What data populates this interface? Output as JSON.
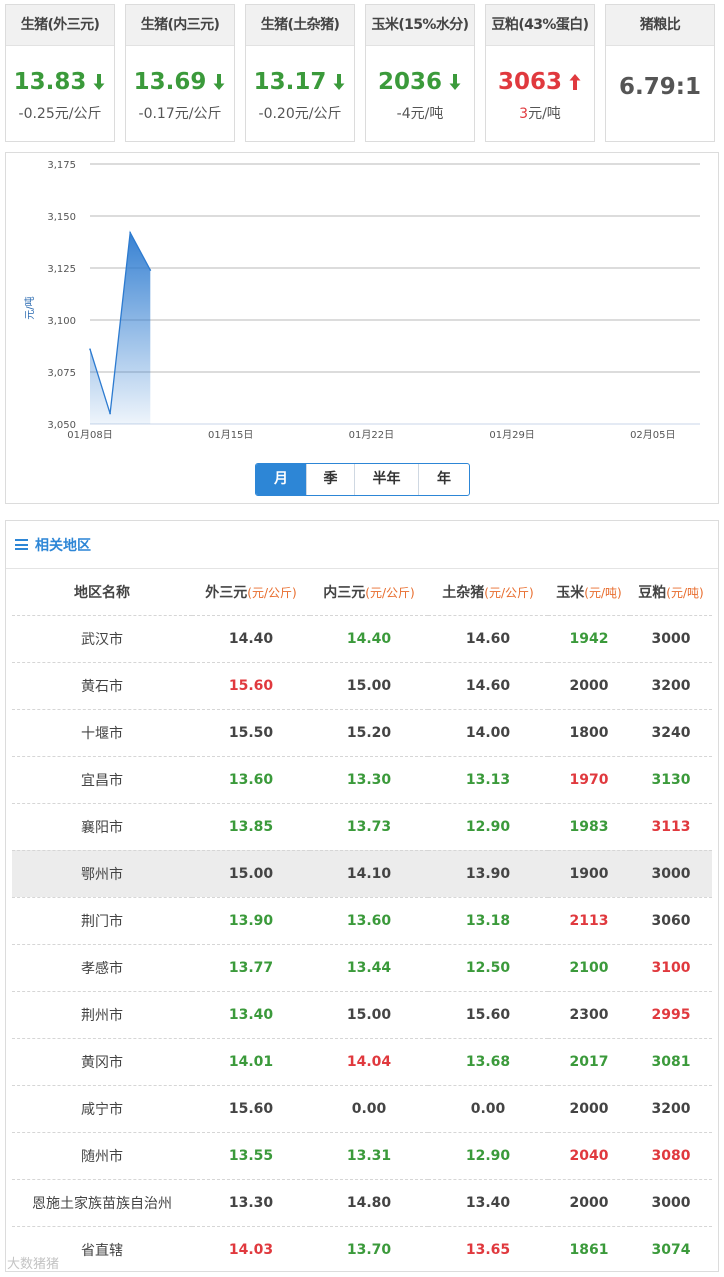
{
  "cards": [
    {
      "title": "生猪(外三元)",
      "price": "13.83",
      "change": "-0.25元/公斤",
      "dir": "down"
    },
    {
      "title": "生猪(内三元)",
      "price": "13.69",
      "change": "-0.17元/公斤",
      "dir": "down"
    },
    {
      "title": "生猪(土杂猪)",
      "price": "13.17",
      "change": "-0.20元/公斤",
      "dir": "down"
    },
    {
      "title": "玉米(15%水分)",
      "price": "2036",
      "change": "-4元/吨",
      "dir": "down"
    },
    {
      "title": "豆粕(43%蛋白)",
      "price": "3063",
      "change": "3元/吨",
      "dir": "up"
    },
    {
      "title": "猪粮比",
      "price": "6.79:1",
      "change": "",
      "dir": "none"
    }
  ],
  "chart_data": {
    "type": "area",
    "ylabel": "元/吨",
    "ylim": [
      3050,
      3175
    ],
    "yticks": [
      "3,175",
      "3,150",
      "3,125",
      "3,100",
      "3,075",
      "3,050"
    ],
    "xticks": [
      "01月08日",
      "01月15日",
      "01月22日",
      "01月29日",
      "02月05日"
    ],
    "x": [
      "01月08日",
      "01月09日",
      "01月10日",
      "01月11日"
    ],
    "values": [
      3086,
      3055,
      3142,
      3124
    ],
    "color": "#2d7bd0"
  },
  "range_tabs": [
    "月",
    "季",
    "半年",
    "年"
  ],
  "region": {
    "title": "相关地区",
    "columns": [
      {
        "label": "地区名称",
        "unit": ""
      },
      {
        "label": "外三元",
        "unit": "(元/公斤)"
      },
      {
        "label": "内三元",
        "unit": "(元/公斤)"
      },
      {
        "label": "土杂猪",
        "unit": "(元/公斤)"
      },
      {
        "label": "玉米",
        "unit": "(元/吨)"
      },
      {
        "label": "豆粕",
        "unit": "(元/吨)"
      }
    ],
    "rows": [
      {
        "name": "武汉市",
        "cells": [
          [
            "14.40",
            ""
          ],
          [
            "14.40",
            "g"
          ],
          [
            "14.60",
            ""
          ],
          [
            "1942",
            "g"
          ],
          [
            "3000",
            ""
          ]
        ]
      },
      {
        "name": "黄石市",
        "cells": [
          [
            "15.60",
            "r"
          ],
          [
            "15.00",
            ""
          ],
          [
            "14.60",
            ""
          ],
          [
            "2000",
            ""
          ],
          [
            "3200",
            ""
          ]
        ]
      },
      {
        "name": "十堰市",
        "cells": [
          [
            "15.50",
            ""
          ],
          [
            "15.20",
            ""
          ],
          [
            "14.00",
            ""
          ],
          [
            "1800",
            ""
          ],
          [
            "3240",
            ""
          ]
        ]
      },
      {
        "name": "宜昌市",
        "cells": [
          [
            "13.60",
            "g"
          ],
          [
            "13.30",
            "g"
          ],
          [
            "13.13",
            "g"
          ],
          [
            "1970",
            "r"
          ],
          [
            "3130",
            "g"
          ]
        ]
      },
      {
        "name": "襄阳市",
        "cells": [
          [
            "13.85",
            "g"
          ],
          [
            "13.73",
            "g"
          ],
          [
            "12.90",
            "g"
          ],
          [
            "1983",
            "g"
          ],
          [
            "3113",
            "r"
          ]
        ]
      },
      {
        "name": "鄂州市",
        "cells": [
          [
            "15.00",
            ""
          ],
          [
            "14.10",
            ""
          ],
          [
            "13.90",
            ""
          ],
          [
            "1900",
            ""
          ],
          [
            "3000",
            ""
          ]
        ]
      },
      {
        "name": "荆门市",
        "cells": [
          [
            "13.90",
            "g"
          ],
          [
            "13.60",
            "g"
          ],
          [
            "13.18",
            "g"
          ],
          [
            "2113",
            "r"
          ],
          [
            "3060",
            ""
          ]
        ]
      },
      {
        "name": "孝感市",
        "cells": [
          [
            "13.77",
            "g"
          ],
          [
            "13.44",
            "g"
          ],
          [
            "12.50",
            "g"
          ],
          [
            "2100",
            "g"
          ],
          [
            "3100",
            "r"
          ]
        ]
      },
      {
        "name": "荆州市",
        "cells": [
          [
            "13.40",
            "g"
          ],
          [
            "15.00",
            ""
          ],
          [
            "15.60",
            ""
          ],
          [
            "2300",
            ""
          ],
          [
            "2995",
            "r"
          ]
        ]
      },
      {
        "name": "黄冈市",
        "cells": [
          [
            "14.01",
            "g"
          ],
          [
            "14.04",
            "r"
          ],
          [
            "13.68",
            "g"
          ],
          [
            "2017",
            "g"
          ],
          [
            "3081",
            "g"
          ]
        ]
      },
      {
        "name": "咸宁市",
        "cells": [
          [
            "15.60",
            ""
          ],
          [
            "0.00",
            ""
          ],
          [
            "0.00",
            ""
          ],
          [
            "2000",
            ""
          ],
          [
            "3200",
            ""
          ]
        ]
      },
      {
        "name": "随州市",
        "cells": [
          [
            "13.55",
            "g"
          ],
          [
            "13.31",
            "g"
          ],
          [
            "12.90",
            "g"
          ],
          [
            "2040",
            "r"
          ],
          [
            "3080",
            "r"
          ]
        ]
      },
      {
        "name": "恩施土家族苗族自治州",
        "cells": [
          [
            "13.30",
            ""
          ],
          [
            "14.80",
            ""
          ],
          [
            "13.40",
            ""
          ],
          [
            "2000",
            ""
          ],
          [
            "3000",
            ""
          ]
        ]
      },
      {
        "name": "省直辖",
        "cells": [
          [
            "14.03",
            "r"
          ],
          [
            "13.70",
            "g"
          ],
          [
            "13.65",
            "r"
          ],
          [
            "1861",
            "g"
          ],
          [
            "3074",
            "g"
          ]
        ]
      }
    ]
  },
  "watermark": "大数猪猪"
}
